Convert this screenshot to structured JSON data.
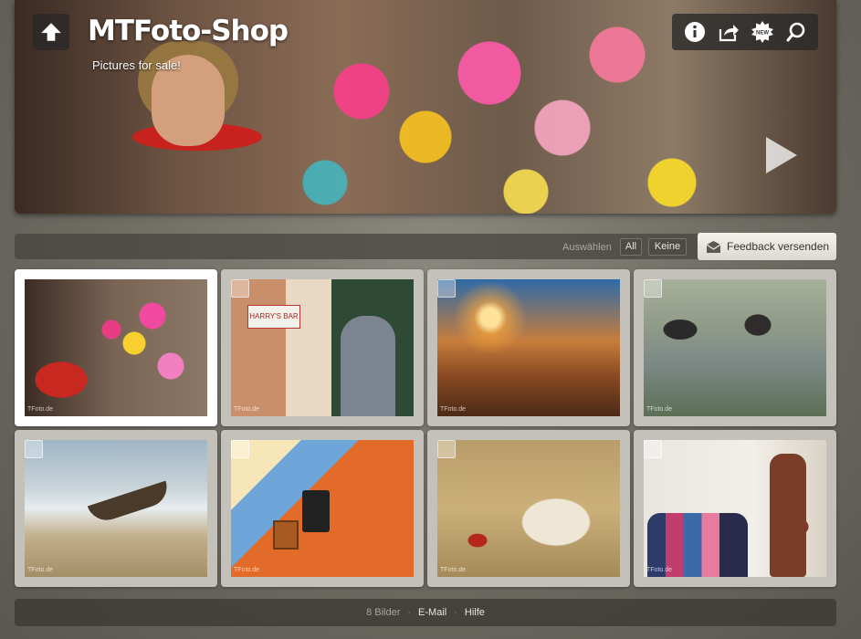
{
  "header": {
    "title": "MTFoto-Shop",
    "subtitle": "Pictures for sale!",
    "toolbar_icons": [
      "info-icon",
      "share-icon",
      "new-badge-icon",
      "search-icon"
    ],
    "new_badge": "NEW"
  },
  "actions": {
    "select_label": "Auswählen",
    "all_label": "All",
    "none_label": "Keine",
    "feedback_label": "Feedback versenden"
  },
  "gallery": {
    "watermark": "TFoto.de",
    "photos": [
      {
        "selected": true
      },
      {
        "selected": false,
        "sign_text": "HARRY'S BAR"
      },
      {
        "selected": false
      },
      {
        "selected": false
      },
      {
        "selected": false
      },
      {
        "selected": false
      },
      {
        "selected": false
      },
      {
        "selected": false
      }
    ]
  },
  "footer": {
    "count": "8 Bilder",
    "email": "E-Mail",
    "help": "Hilfe",
    "separator": "·"
  }
}
